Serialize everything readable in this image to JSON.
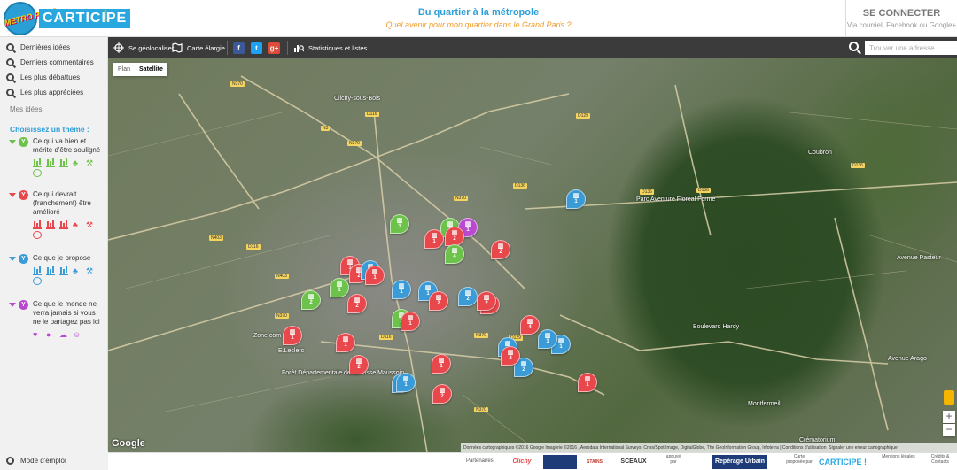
{
  "header": {
    "logo_badge": "METRO POP !",
    "logo_text": "CARTICIPE",
    "logo_excl": "!",
    "title": "Du quartier à la métropole",
    "subtitle": "Quel avenir pour mon quartier dans le Grand Paris ?",
    "login_title": "SE CONNECTER",
    "login_sub": "Via courriel, Facebook ou Google+"
  },
  "sidebar": {
    "links": [
      {
        "label": "Dernières idées"
      },
      {
        "label": "Derniers commentaires"
      },
      {
        "label": "Les plus débattues"
      },
      {
        "label": "Les plus appréciées"
      }
    ],
    "mes_idees": "Mes idées",
    "theme_title": "Choisissez un thème :",
    "themes": [
      {
        "label": "Ce qui va bien et mérite d'être souligné",
        "color": "#6cc24a",
        "icon_letter": "Y"
      },
      {
        "label": "Ce qui devrait (franchement) être amélioré",
        "color": "#e8474c",
        "icon_letter": "Y"
      },
      {
        "label": "Ce que je propose",
        "color": "#3a9bd6",
        "icon_letter": "Y"
      },
      {
        "label": "Ce que le monde ne verra jamais si vous ne le partagez pas ici",
        "color": "#b94ad0",
        "icon_letter": "Y"
      }
    ],
    "mode_emploi": "Mode d'emploi"
  },
  "toolbar": {
    "geoloc": "Se géolocaliser",
    "carte_elargie": "Carte élargie",
    "stats": "Statistiques et listes",
    "search_placeholder": "Trouver une adresse",
    "facebook": "f",
    "twitter": "t",
    "googleplus": "g+"
  },
  "map": {
    "tab_plan": "Plan",
    "tab_satellite": "Satellite",
    "google": "Google",
    "attribution": "Données cartographiques ©2016 Google Imagerie ©2016 , Aerodata International Surveys, Cnes/Spot Image, DigitalGlobe, The GeoInformation Group, Infoterra | Conditions d'utilisation",
    "report": "Signaler une erreur cartographique",
    "zoom_in": "+",
    "zoom_out": "−",
    "places": [
      {
        "text": "Clichy-sous-Bois"
      },
      {
        "text": "Zone com"
      },
      {
        "text": "E.Leclerc"
      },
      {
        "text": "Forêt Départementale de la Fosse Maussoin"
      },
      {
        "text": "Parc Aventure Floréal Forme"
      },
      {
        "text": "Coubron"
      },
      {
        "text": "Montfermeil"
      },
      {
        "text": "Avenue Pasteur"
      },
      {
        "text": "Boulevard Hardy"
      },
      {
        "text": "Avenue Arago"
      },
      {
        "text": "Crématorium"
      }
    ],
    "roads": [
      "N370",
      "D116",
      "N3",
      "N370",
      "D129",
      "D136",
      "D136",
      "D136",
      "N403",
      "D116",
      "N403",
      "N370",
      "D116",
      "N370",
      "D136",
      "N370",
      "D129",
      "N370"
    ],
    "markers": [
      {
        "color": "#e8474c",
        "count": "1"
      },
      {
        "color": "#e8474c",
        "count": "2"
      },
      {
        "color": "#e8474c",
        "count": "1"
      },
      {
        "color": "#6cc24a",
        "count": "1"
      },
      {
        "color": "#6cc24a",
        "count": "1"
      },
      {
        "color": "#b94ad0",
        "count": "1"
      },
      {
        "color": "#e8474c",
        "count": "1"
      },
      {
        "color": "#e8474c",
        "count": "2"
      },
      {
        "color": "#6cc24a",
        "count": "4"
      },
      {
        "color": "#e8474c",
        "count": "2"
      },
      {
        "color": "#3a9bd6",
        "count": "1"
      },
      {
        "color": "#e8474c",
        "count": "1"
      },
      {
        "color": "#6cc24a",
        "count": "2"
      },
      {
        "color": "#6cc24a",
        "count": "1"
      },
      {
        "color": "#e8474c",
        "count": "2"
      },
      {
        "color": "#3a9bd6",
        "count": "1"
      },
      {
        "color": "#3a9bd6",
        "count": "1"
      },
      {
        "color": "#e8474c",
        "count": "2"
      },
      {
        "color": "#3a9bd6",
        "count": "2"
      },
      {
        "color": "#e8474c",
        "count": "1"
      },
      {
        "color": "#e8474c",
        "count": "2"
      },
      {
        "color": "#6cc24a",
        "count": "2"
      },
      {
        "color": "#e8474c",
        "count": "1"
      },
      {
        "color": "#e8474c",
        "count": "4"
      },
      {
        "color": "#3a9bd6",
        "count": "1"
      },
      {
        "color": "#3a9bd6",
        "count": "1"
      },
      {
        "color": "#3a9bd6",
        "count": "1"
      },
      {
        "color": "#e8474c",
        "count": "1"
      },
      {
        "color": "#e8474c",
        "count": "1"
      },
      {
        "color": "#e8474c",
        "count": "2"
      },
      {
        "color": "#3a9bd6",
        "count": "2"
      },
      {
        "color": "#e8474c",
        "count": "2"
      },
      {
        "color": "#3a9bd6",
        "count": "1"
      },
      {
        "color": "#e8474c",
        "count": "1"
      },
      {
        "color": "#3a9bd6",
        "count": "1"
      },
      {
        "color": "#3a9bd6",
        "count": "1"
      },
      {
        "color": "#e8474c",
        "count": "2"
      }
    ]
  },
  "footer": {
    "partenaires": "Partenaires",
    "clichy": "Clichy",
    "stains": "STAINS",
    "sceaux": "SCEAUX",
    "appuye_par": "appuyé par",
    "reperage": "Repérage Urbain",
    "carte_proposee": "Carte proposée par",
    "carticipe": "CARTICIPE !",
    "mentions": "Mentions légales",
    "credits": "Crédits & Contacts"
  }
}
